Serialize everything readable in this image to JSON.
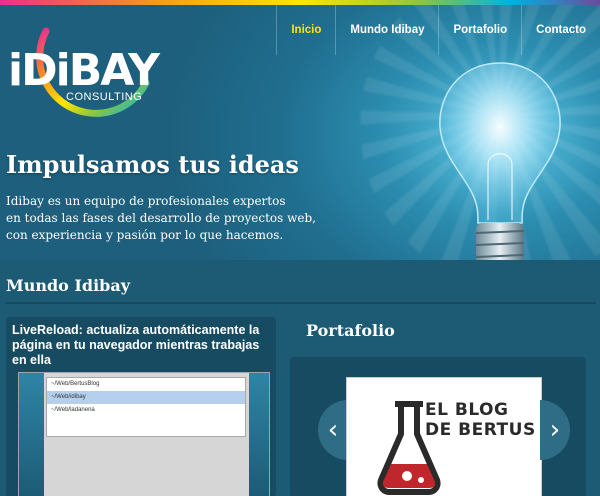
{
  "brand": {
    "logo_text": "iDiBAY",
    "logo_sub": "CONSULTING"
  },
  "nav": {
    "items": [
      {
        "label": "Inicio",
        "active": true
      },
      {
        "label": "Mundo Idibay",
        "active": false
      },
      {
        "label": "Portafolio",
        "active": false
      },
      {
        "label": "Contacto",
        "active": false
      }
    ]
  },
  "hero": {
    "title": "Impulsamos tus ideas",
    "text_line1": "Idibay es un equipo de profesionales expertos",
    "text_line2": "en todas las fases del desarrollo de proyectos web,",
    "text_line3": "con experiencia y pasión por lo que hacemos."
  },
  "mundo": {
    "heading": "Mundo Idibay",
    "post_title": "LiveReload: actualiza automáticamente la página en tu navegador mientras trabajas en ella",
    "screenshot_rows": [
      {
        "label": "~/Web/BertusBlog",
        "selected": false
      },
      {
        "label": "~/Web/idibay",
        "selected": true
      },
      {
        "label": "~/Web/ladanena",
        "selected": false
      }
    ]
  },
  "portafolio": {
    "heading": "Portafolio",
    "item_line1": "EL BLOG",
    "item_line2": "DE BERTUS",
    "prev_icon": "chevron-left-icon",
    "next_icon": "chevron-right-icon"
  },
  "colors": {
    "accent": "#ffe600",
    "background": "#1f5e78",
    "blog_red": "#c0272d"
  }
}
